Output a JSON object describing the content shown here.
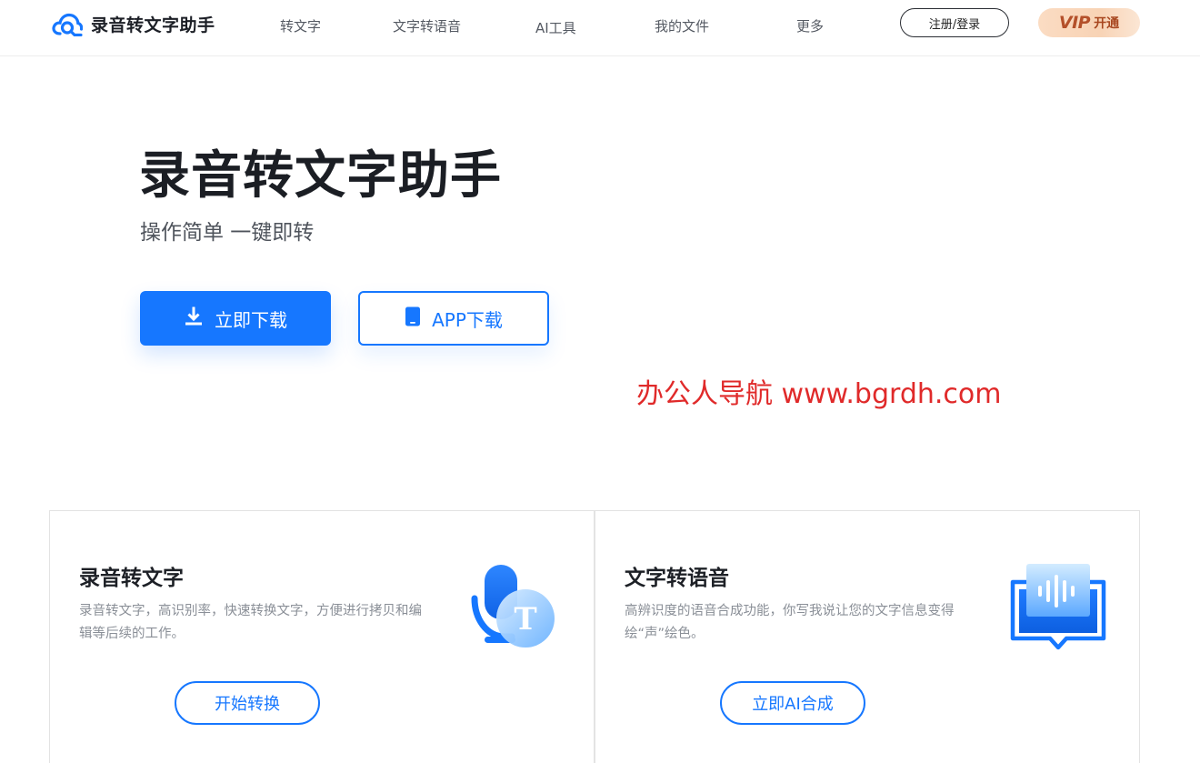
{
  "header": {
    "logo_icon": "cloud-logo-icon",
    "app_name": "录音转文字助手",
    "nav": [
      {
        "label": "转文字"
      },
      {
        "label": "文字转语音"
      },
      {
        "label": "AI工具"
      },
      {
        "label": "我的文件"
      },
      {
        "label": "更多"
      }
    ],
    "login_label": "注册/登录",
    "vip_word": "VIP",
    "vip_label": "开通"
  },
  "hero": {
    "title": "录音转文字助手",
    "subtitle": "操作简单 一键即转",
    "download_label": "立即下载",
    "download_icon": "download-icon",
    "app_download_label": "APP下载",
    "app_icon": "phone-icon"
  },
  "watermark": "办公人导航 www.bgrdh.com",
  "features": [
    {
      "title": "录音转文字",
      "description": "录音转文字，高识别率，快速转换文字，方便进行拷贝和编辑等后续的工作。",
      "button": "开始转换",
      "icon": "microphone-text-icon",
      "icon_letter": "T"
    },
    {
      "title": "文字转语音",
      "description": "高辨识度的语音合成功能，你写我说让您的文字信息变得绘“声”绘色。",
      "button": "立即AI合成",
      "icon": "voice-book-icon"
    }
  ],
  "colors": {
    "primary": "#1677ff",
    "watermark": "#e02a2a",
    "vip_text": "#b4502a",
    "vip_bg": "#fbdcc3"
  }
}
